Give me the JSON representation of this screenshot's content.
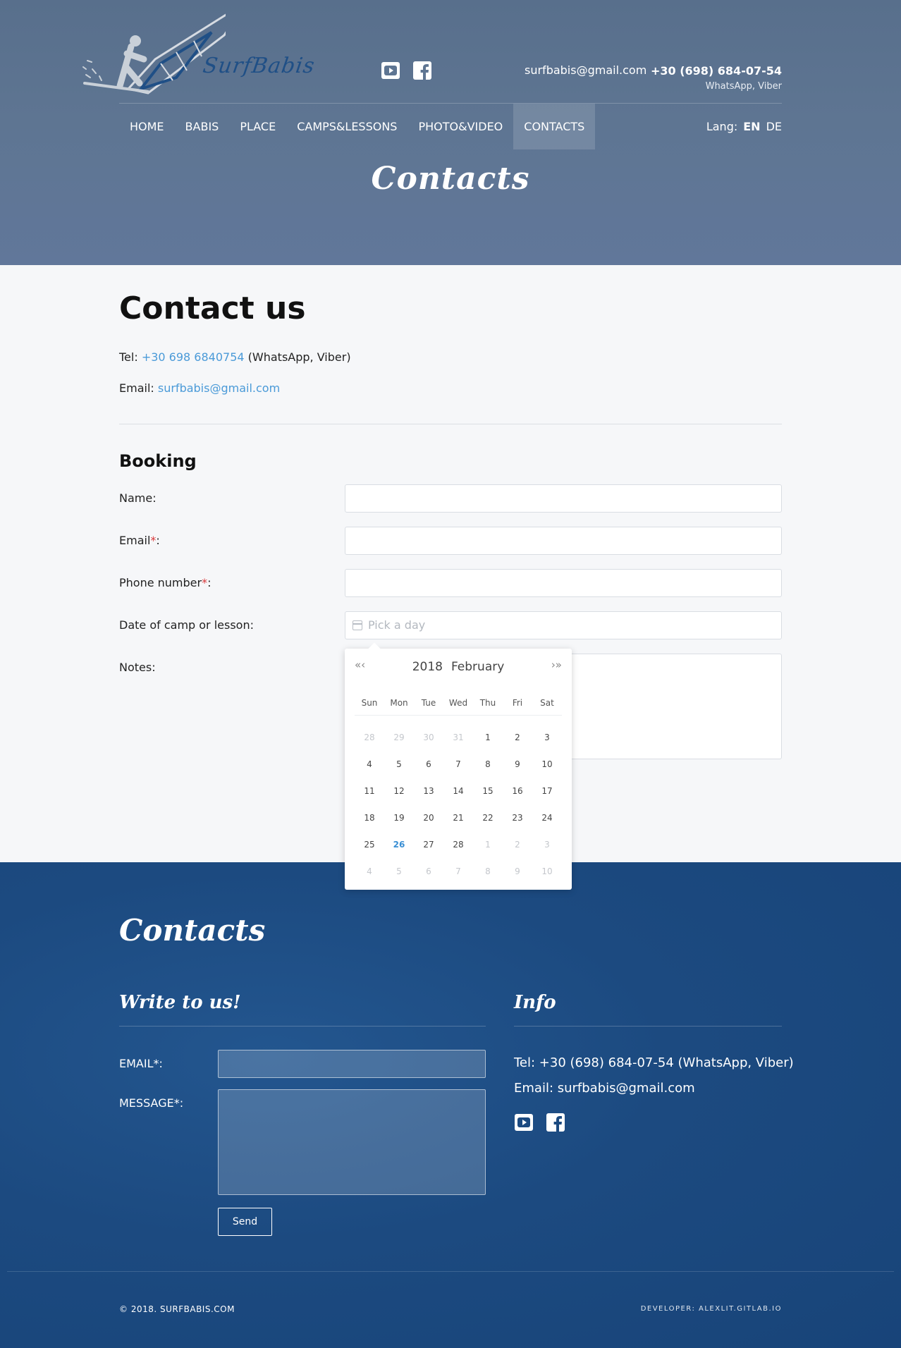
{
  "header": {
    "logo_text": "SurfBabis",
    "email": "surfbabis@gmail.com",
    "phone": "+30 (698) 684-07-54",
    "phone_note": "WhatsApp, Viber",
    "social": [
      "youtube-icon",
      "facebook-icon"
    ]
  },
  "nav": {
    "items": [
      {
        "label": "HOME",
        "active": false
      },
      {
        "label": "BABIS",
        "active": false
      },
      {
        "label": "PLACE",
        "active": false
      },
      {
        "label": "CAMPS&LESSONS",
        "active": false
      },
      {
        "label": "PHOTO&VIDEO",
        "active": false
      },
      {
        "label": "CONTACTS",
        "active": true
      }
    ],
    "lang_label": "Lang:",
    "lang_en": "EN",
    "lang_de": "DE"
  },
  "hero": {
    "title": "Contacts"
  },
  "contact": {
    "heading": "Contact us",
    "tel_label": "Tel:",
    "tel_value": "+30 698 6840754",
    "tel_note": "(WhatsApp, Viber)",
    "email_label": "Email:",
    "email_value": "surfbabis@gmail.com"
  },
  "booking": {
    "heading": "Booking",
    "name_label": "Name:",
    "email_label": "Email",
    "phone_label": "Phone number",
    "required_mark": "*",
    "label_colon": ":",
    "date_label": "Date of camp or lesson:",
    "date_placeholder": "Pick a day",
    "notes_label": "Notes:"
  },
  "datepicker": {
    "prev": "«‹",
    "next": "›»",
    "year": "2018",
    "month": "February",
    "weekdays": [
      "Sun",
      "Mon",
      "Tue",
      "Wed",
      "Thu",
      "Fri",
      "Sat"
    ],
    "days": [
      {
        "d": "28",
        "muted": true
      },
      {
        "d": "29",
        "muted": true
      },
      {
        "d": "30",
        "muted": true
      },
      {
        "d": "31",
        "muted": true
      },
      {
        "d": "1"
      },
      {
        "d": "2"
      },
      {
        "d": "3"
      },
      {
        "d": "4"
      },
      {
        "d": "5"
      },
      {
        "d": "6"
      },
      {
        "d": "7"
      },
      {
        "d": "8"
      },
      {
        "d": "9"
      },
      {
        "d": "10"
      },
      {
        "d": "11"
      },
      {
        "d": "12"
      },
      {
        "d": "13"
      },
      {
        "d": "14"
      },
      {
        "d": "15"
      },
      {
        "d": "16"
      },
      {
        "d": "17"
      },
      {
        "d": "18"
      },
      {
        "d": "19"
      },
      {
        "d": "20"
      },
      {
        "d": "21"
      },
      {
        "d": "22"
      },
      {
        "d": "23"
      },
      {
        "d": "24"
      },
      {
        "d": "25"
      },
      {
        "d": "26",
        "today": true
      },
      {
        "d": "27"
      },
      {
        "d": "28"
      },
      {
        "d": "1",
        "muted": true
      },
      {
        "d": "2",
        "muted": true
      },
      {
        "d": "3",
        "muted": true
      },
      {
        "d": "4",
        "muted": true
      },
      {
        "d": "5",
        "muted": true
      },
      {
        "d": "6",
        "muted": true
      },
      {
        "d": "7",
        "muted": true
      },
      {
        "d": "8",
        "muted": true
      },
      {
        "d": "9",
        "muted": true
      },
      {
        "d": "10",
        "muted": true
      }
    ]
  },
  "footer": {
    "title": "Contacts",
    "write_heading": "Write to us!",
    "info_heading": "Info",
    "email_label": "EMAIL*:",
    "message_label": "MESSAGE*:",
    "send_label": "Send",
    "info_tel": "Tel: +30 (698) 684-07-54 (WhatsApp, Viber)",
    "info_email": "Email: surfbabis@gmail.com",
    "copyright": "© 2018. SURFBABIS.COM",
    "developer": "DEVELOPER: ALEXLIT.GITLAB.IO"
  },
  "colors": {
    "header_bg": "#5e7592",
    "link": "#4a9ad8",
    "required": "#d9383a",
    "footer_bg": "#1c4a80",
    "today": "#3a8fd4"
  }
}
